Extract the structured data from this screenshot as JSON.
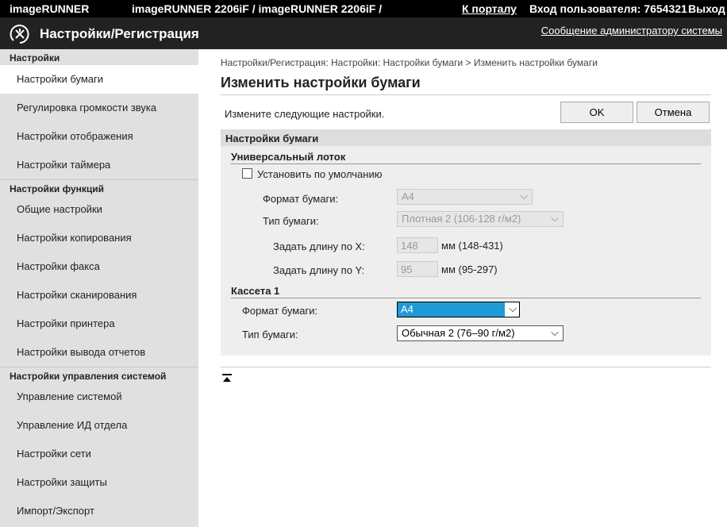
{
  "topbar": {
    "brand": "imageRUNNER",
    "device": "imageRUNNER 2206iF / imageRUNNER 2206iF /",
    "portal": "К порталу",
    "login": "Вход пользователя: 7654321",
    "logout": "Выход"
  },
  "header": {
    "title": "Настройки/Регистрация",
    "admin_msg": "Сообщение администратору системы"
  },
  "sidebar": {
    "sections": [
      {
        "title": "Настройки",
        "items": [
          "Настройки бумаги",
          "Регулировка громкости звука",
          "Настройки отображения",
          "Настройки таймера"
        ]
      },
      {
        "title": "Настройки функций",
        "items": [
          "Общие настройки",
          "Настройки копирования",
          "Настройки факса",
          "Настройки сканирования",
          "Настройки принтера",
          "Настройки вывода отчетов"
        ]
      },
      {
        "title": "Настройки управления системой",
        "items": [
          "Управление системой",
          "Управление ИД отдела",
          "Настройки сети",
          "Настройки защиты",
          "Импорт/Экспорт"
        ]
      }
    ]
  },
  "main": {
    "breadcrumb": "Настройки/Регистрация: Настройки: Настройки бумаги > Изменить настройки бумаги",
    "title": "Изменить настройки бумаги",
    "instruction": "Измените следующие настройки.",
    "ok": "OK",
    "cancel": "Отмена",
    "panel_title": "Настройки бумаги",
    "mp": {
      "title": "Универсальный лоток",
      "default_label": "Установить по умолчанию",
      "format_label": "Формат бумаги:",
      "format_value": "A4",
      "type_label": "Тип бумаги:",
      "type_value": "Плотная 2 (106-128 г/м2)",
      "x_label": "Задать длину по X:",
      "x_value": "148",
      "x_range": "мм (148-431)",
      "y_label": "Задать длину по Y:",
      "y_value": "95",
      "y_range": "мм (95-297)"
    },
    "cassette": {
      "title": "Кассета 1",
      "format_label": "Формат бумаги:",
      "format_value": "A4",
      "type_label": "Тип бумаги:",
      "type_value": "Обычная 2 (76–90 г/м2)"
    }
  },
  "colors": {
    "highlight": "#1e9ad6"
  }
}
